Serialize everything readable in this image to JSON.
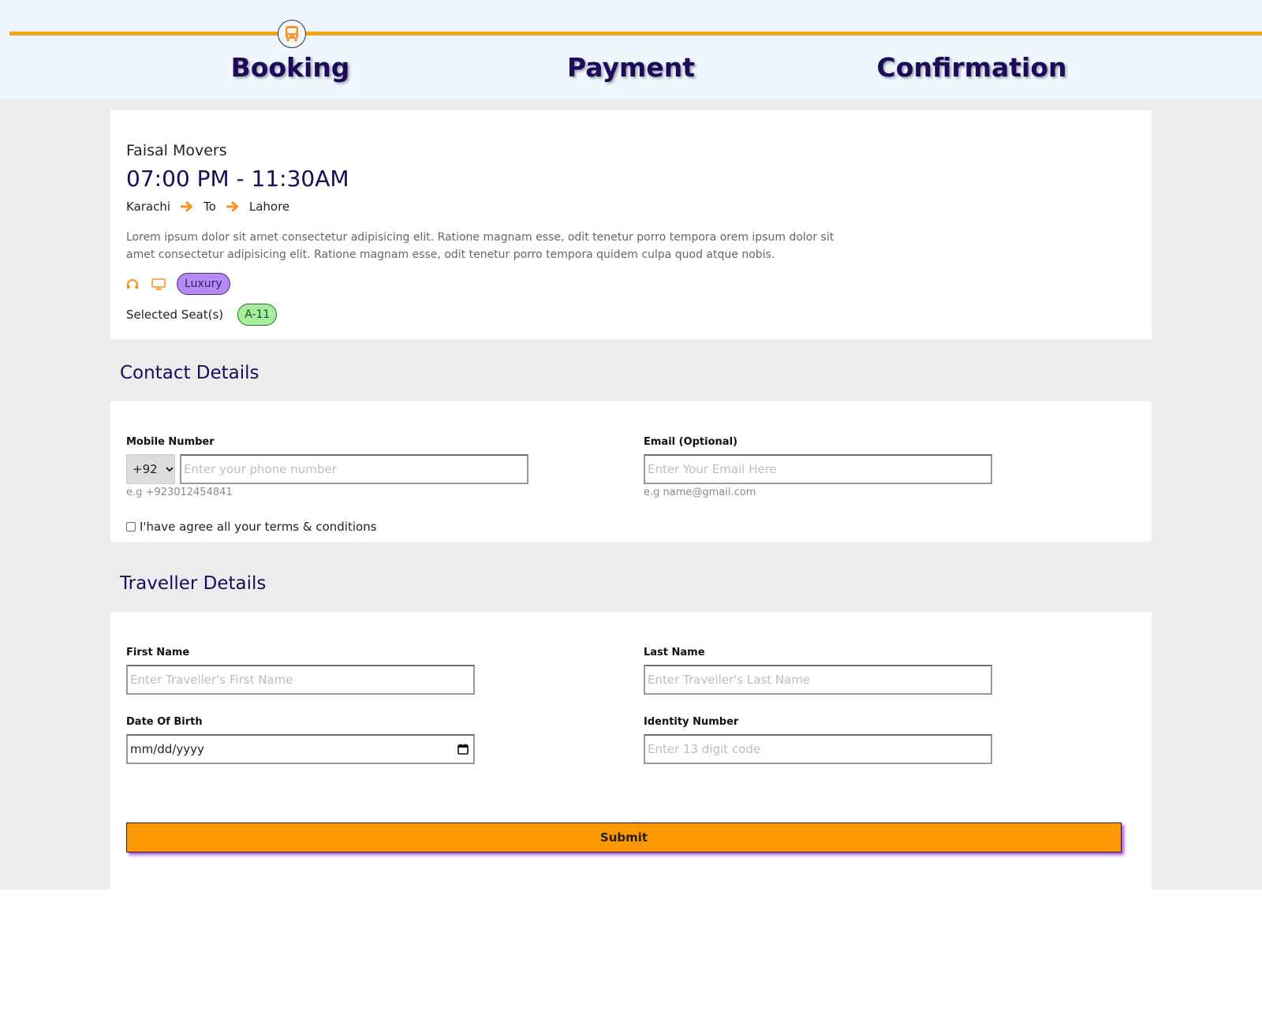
{
  "steps": {
    "booking": "Booking",
    "payment": "Payment",
    "confirmation": "Confirmation"
  },
  "trip": {
    "operator": "Faisal Movers",
    "time": "07:00 PM - 11:30AM",
    "from": "Karachi",
    "to_word": "To",
    "to": "Lahore",
    "description": "Lorem ipsum dolor sit amet consectetur adipisicing elit. Ratione magnam esse, odit tenetur porro tempora orem ipsum dolor sit amet consectetur adipisicing elit. Ratione magnam esse, odit tenetur porro tempora quidem culpa quod atque nobis.",
    "amenities": [
      "headphones-icon",
      "monitor-icon"
    ],
    "class_badge": "Luxury",
    "seats_label": "Selected Seat(s)",
    "seat": "A-11"
  },
  "contact": {
    "title": "Contact Details",
    "mobile_label": "Mobile Number",
    "country_code": "+92",
    "phone_placeholder": "Enter your phone number",
    "phone_hint": "e.g +923012454841",
    "email_label": "Email (Optional)",
    "email_placeholder": "Enter Your Email Here",
    "email_hint": "e.g name@gmail.com",
    "agree_text": "I'have agree all your terms & conditions"
  },
  "traveller": {
    "title": "Traveller Details",
    "first_label": "First Name",
    "first_placeholder": "Enter Traveller's First Name",
    "last_label": "Last Name",
    "last_placeholder": "Enter Traveller's Last Name",
    "dob_label": "Date Of Birth",
    "dob_value": "mm/dd/yyyy",
    "id_label": "Identity Number",
    "id_placeholder": "Enter 13 digit code",
    "submit_label": "Submit"
  },
  "colors": {
    "accent": "#f7a21b",
    "heading": "#1e0a5b",
    "submit": "#fe9800",
    "luxury": "#b48bf3",
    "seat": "#a5ee9d"
  }
}
